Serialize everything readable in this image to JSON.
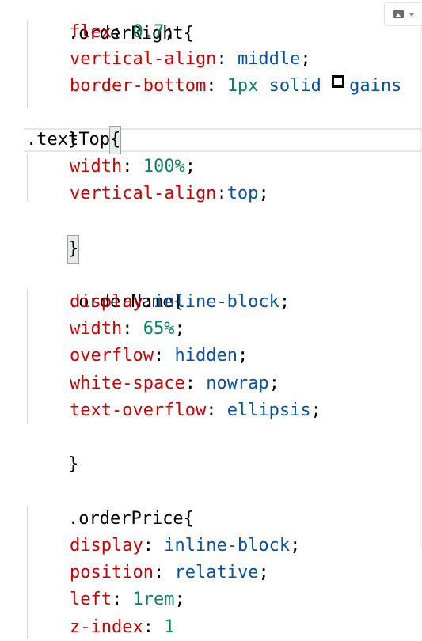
{
  "toolbar": {
    "image_button_icon": "image-icon",
    "image_button_caret": "chevron-down-icon"
  },
  "code": {
    "l01_sel": ".orderRight{",
    "l02_prop": "flex",
    "l02_colon": ": ",
    "l02_val": "0.7",
    "l02_end": ";",
    "l03_prop": "vertical-align",
    "l03_colon": ": ",
    "l03_val": "middle",
    "l03_end": ";",
    "l04_prop": "border-bottom",
    "l04_colon": ": ",
    "l04_num": "1px",
    "l04_kw": " solid ",
    "l04_color": "gains",
    "l05_close": "}",
    "l06_sel": ".textTop",
    "l06_brace": "{",
    "l07_prop": "width",
    "l07_colon": ": ",
    "l07_val": "100%",
    "l07_end": ";",
    "l08_prop": "vertical-align",
    "l08_colon": ":",
    "l08_val": "top",
    "l08_end": ";",
    "l09_close": "}",
    "l11_sel": ".orderName{",
    "l12_prop": "display",
    "l12_colon": ":",
    "l12_val": "inline-block",
    "l12_end": ";",
    "l13_prop": "width",
    "l13_colon": ": ",
    "l13_val": "65%",
    "l13_end": ";",
    "l14_prop": "overflow",
    "l14_colon": ": ",
    "l14_val": "hidden",
    "l14_end": ";",
    "l15_prop": "white-space",
    "l15_colon": ": ",
    "l15_val": "nowrap",
    "l15_end": ";",
    "l16_prop": "text-overflow",
    "l16_colon": ": ",
    "l16_val": "ellipsis",
    "l16_end": ";",
    "l17_close": "}",
    "l19_sel": ".orderPrice{",
    "l21_prop": "display",
    "l21_colon": ": ",
    "l21_val": "inline-block",
    "l21_end": ";",
    "l22_prop": "position",
    "l22_colon": ": ",
    "l22_val": "relative",
    "l22_end": ";",
    "l23_prop": "left",
    "l23_colon": ": ",
    "l23_val": "1rem",
    "l23_end": ";",
    "l24_prop": "z-index",
    "l24_colon": ": ",
    "l24_val": "1"
  },
  "colors": {
    "property": "#cc0000",
    "number": "#098658",
    "keyword": "#0451a5",
    "selector": "#000000",
    "swatch": "#000000"
  }
}
